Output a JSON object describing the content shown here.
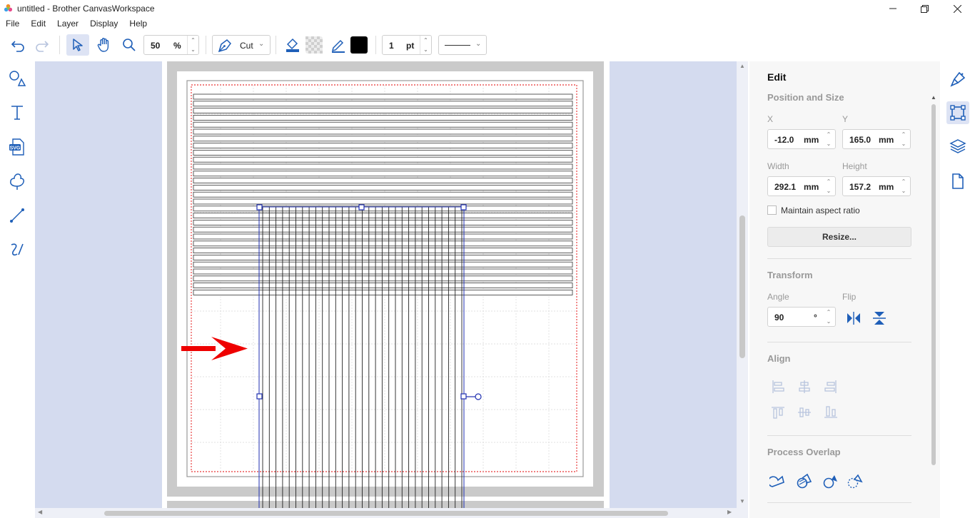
{
  "window": {
    "title": "untitled - Brother CanvasWorkspace"
  },
  "menu": [
    "File",
    "Edit",
    "Layer",
    "Display",
    "Help"
  ],
  "toolbar": {
    "zoom_value": "50",
    "zoom_unit": "%",
    "mode_label": "Cut",
    "line_width_value": "1",
    "line_width_unit": "pt"
  },
  "panel": {
    "title": "Edit",
    "position_size": {
      "heading": "Position and Size",
      "x_label": "X",
      "x_value": "-12.0",
      "y_label": "Y",
      "y_value": "165.0",
      "width_label": "Width",
      "width_value": "292.1",
      "height_label": "Height",
      "height_value": "157.2",
      "unit": "mm",
      "maintain_aspect": "Maintain aspect ratio",
      "resize_button": "Resize..."
    },
    "transform": {
      "heading": "Transform",
      "angle_label": "Angle",
      "angle_value": "90",
      "angle_unit": "°",
      "flip_label": "Flip"
    },
    "align": {
      "heading": "Align"
    },
    "overlap": {
      "heading": "Process Overlap"
    }
  },
  "colors": {
    "canvas_bg": "#d4dbef",
    "selection": "#1f2fb0",
    "arrow": "#ee0000",
    "active_rail": "#dde3f4"
  }
}
